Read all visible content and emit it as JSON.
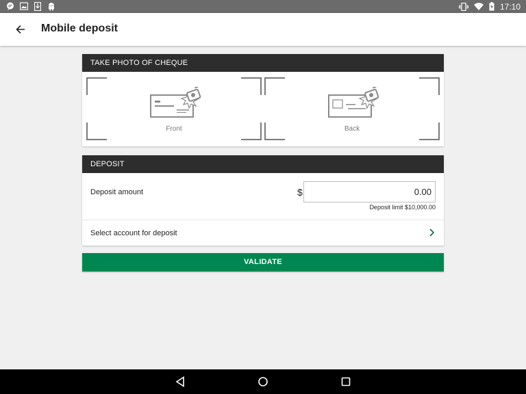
{
  "status_bar": {
    "time": "17:10",
    "left_icons": [
      "chat-notification-icon",
      "image-notification-icon",
      "download-notification-icon",
      "android-notification-icon"
    ],
    "right_icons": [
      "vibrate-icon",
      "wifi-icon",
      "battery-charging-icon"
    ]
  },
  "app_bar": {
    "title": "Mobile deposit",
    "back_icon": "arrow-back-icon"
  },
  "photo_section": {
    "header": "TAKE PHOTO OF CHEQUE",
    "front_label": "Front",
    "back_label": "Back"
  },
  "deposit_section": {
    "header": "DEPOSIT",
    "amount_label": "Deposit amount",
    "currency_symbol": "$",
    "amount_value": "0.00",
    "limit_text": "Deposit limit $10,000.00",
    "account_label": "Select account for deposit"
  },
  "validate_button": {
    "label": "VALIDATE"
  },
  "colors": {
    "status_bar": "#6b6b6b",
    "card_header": "#2d2d2d",
    "validate_green": "#008751",
    "background": "#f0f0f0"
  }
}
